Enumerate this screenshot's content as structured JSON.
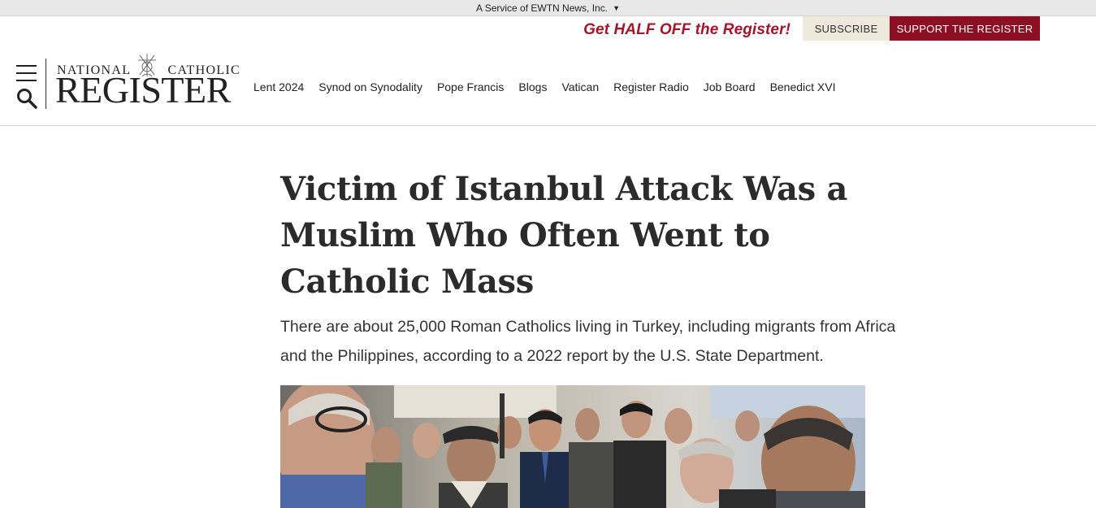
{
  "service_bar": {
    "text": "A Service of EWTN News, Inc.",
    "caret": "▼"
  },
  "promo": {
    "text": "Get HALF OFF the Register!",
    "subscribe_label": "SUBSCRIBE",
    "support_label": "SUPPORT THE REGISTER"
  },
  "logo": {
    "line1_left": "NATIONAL",
    "line1_right": "CATHOLIC",
    "line2": "REGISTER"
  },
  "nav": {
    "items": [
      {
        "label": "Lent 2024"
      },
      {
        "label": "Synod on Synodality"
      },
      {
        "label": "Pope Francis"
      },
      {
        "label": "Blogs"
      },
      {
        "label": "Vatican"
      },
      {
        "label": "Register Radio"
      },
      {
        "label": "Job Board"
      },
      {
        "label": "Benedict XVI"
      }
    ]
  },
  "article": {
    "headline": "Victim of Istanbul Attack Was a Muslim Who Often Went to Catholic Mass",
    "dek": "There are about 25,000 Roman Catholics living in Turkey, including migrants from Africa and the Philippines, according to a 2022 report by the U.S. State Department."
  },
  "colors": {
    "brand": "#8c0f24",
    "promo": "#a3152b",
    "subscribe_bg": "#efe9dc"
  },
  "icons": {
    "menu": "hamburger-menu-icon",
    "search": "search-icon",
    "caret": "caret-down-icon"
  }
}
